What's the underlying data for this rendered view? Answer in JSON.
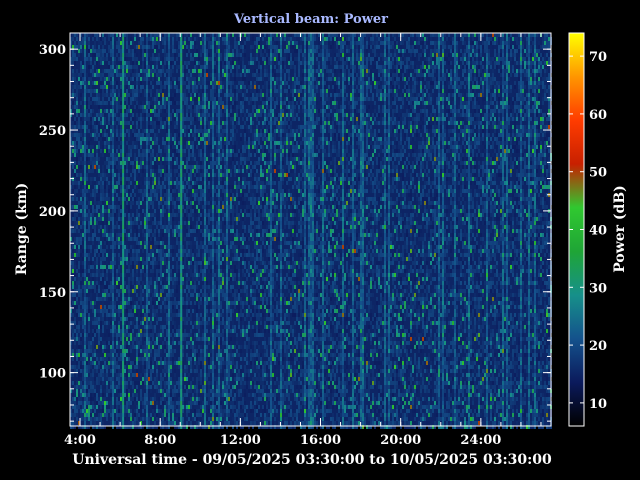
{
  "chart_data": {
    "type": "heatmap",
    "title": "Vertical beam: Power",
    "xlabel": "Universal time - 09/05/2025 03:30:00 to 10/05/2025 03:30:00",
    "ylabel": "Range (km)",
    "x_unit": "hours (UT, from 09/05/2025 00:00)",
    "xlim": [
      3.5,
      27.5
    ],
    "ylim": [
      67,
      310
    ],
    "x_ticks": [
      4,
      8,
      12,
      16,
      20,
      24
    ],
    "x_tick_labels": [
      "4:00",
      "8:00",
      "12:00",
      "16:00",
      "20:00",
      "24:00"
    ],
    "y_ticks": [
      100,
      150,
      200,
      250,
      300
    ],
    "y_tick_labels": [
      "100",
      "150",
      "200",
      "250",
      "300"
    ],
    "colorbar": {
      "label": "Power (dB)",
      "range": [
        6,
        74
      ],
      "ticks": [
        10,
        20,
        30,
        40,
        50,
        60,
        70
      ],
      "tick_labels": [
        "10",
        "20",
        "30",
        "40",
        "50",
        "60",
        "70"
      ],
      "colormap": [
        "#000000",
        "#0b1a5c",
        "#14528c",
        "#16908a",
        "#1fa536",
        "#30c830",
        "#c82000",
        "#ff3c00",
        "#ff9600",
        "#ffff00"
      ]
    },
    "background_power_db": 15,
    "enhanced_columns_hours": [
      6.1,
      9.0
    ],
    "colors": {
      "title": "#a9b9ff",
      "axes": "#ffffff",
      "background": "#000000"
    }
  }
}
